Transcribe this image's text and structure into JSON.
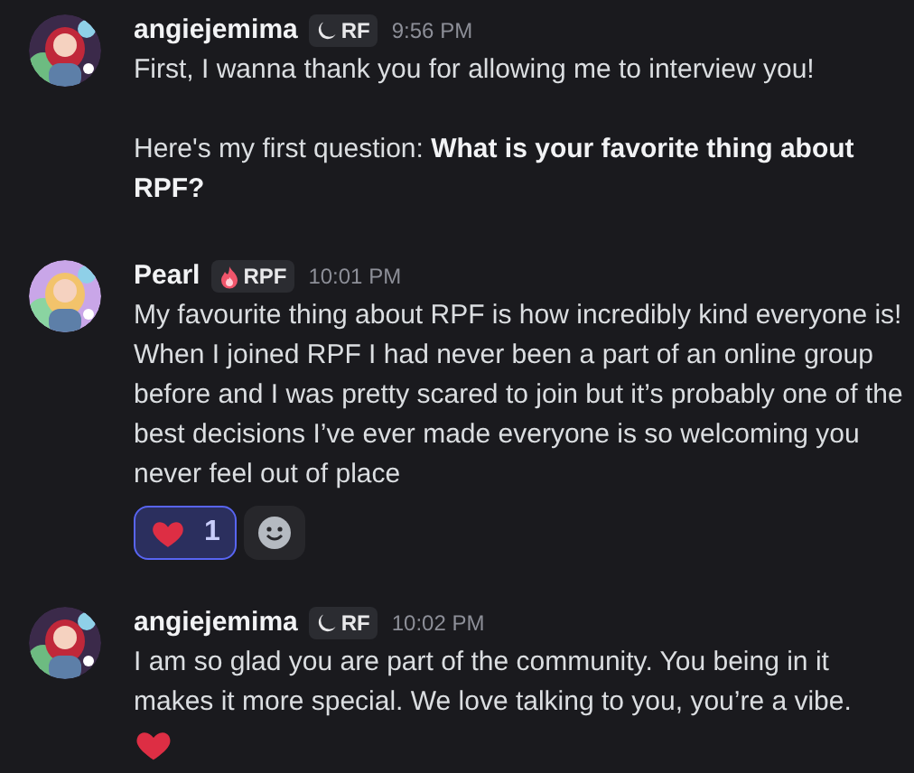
{
  "messages": [
    {
      "author": "angiejemima",
      "tag": {
        "kind": "moon",
        "label": "RF"
      },
      "time": "9:56 PM",
      "avatar": {
        "kind": "picture"
      },
      "paragraphs": [
        "First, I wanna thank you for allowing me to interview you!",
        "Here's my first question: **What is your favorite thing about RPF?**"
      ]
    },
    {
      "author": "Pearl",
      "tag": {
        "kind": "flame",
        "label": "RPF"
      },
      "time": "10:01 PM",
      "avatar": {
        "kind": "picture"
      },
      "paragraphs": [
        "My favourite thing about RPF is how incredibly kind everyone is! When I joined RPF I had never been a part of an online group before and I was pretty scared to join but it’s probably one of the best decisions I’ve ever made everyone is so welcoming you never feel out of place"
      ],
      "reactions": [
        {
          "kind": "heart",
          "count": "1",
          "selected": true
        }
      ]
    },
    {
      "author": "angiejemima",
      "tag": {
        "kind": "moon",
        "label": "RF"
      },
      "time": "10:02 PM",
      "avatar": {
        "kind": "picture"
      },
      "paragraphs": [
        "I am so glad you are part of the community. You being in it makes it more special. We love talking to you, you’re a vibe."
      ],
      "emoji": {
        "kind": "heart"
      }
    }
  ]
}
